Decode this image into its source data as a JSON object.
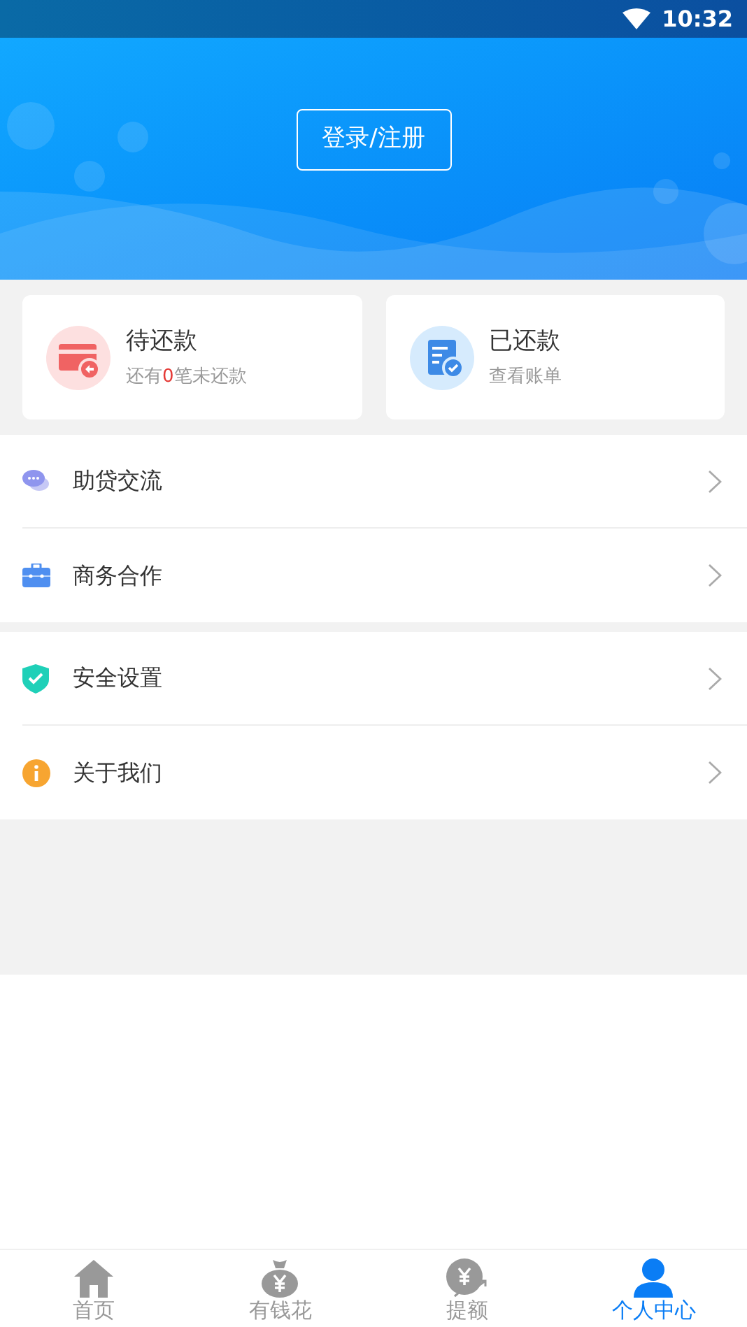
{
  "status_bar": {
    "time": "10:32"
  },
  "header": {
    "login_button": "登录/注册"
  },
  "cards": [
    {
      "kind": "pending",
      "title": "待还款",
      "subtitle": {
        "before": "还有",
        "count": "0",
        "after": "笔未还款"
      }
    },
    {
      "kind": "paid",
      "title": "已还款",
      "subtitle": {
        "before": "查看账单"
      }
    }
  ],
  "menu_groups": [
    [
      {
        "kind": "chat",
        "label": "助贷交流"
      },
      {
        "kind": "briefcase",
        "label": "商务合作"
      }
    ],
    [
      {
        "kind": "shield",
        "label": "安全设置"
      },
      {
        "kind": "info",
        "label": "关于我们"
      }
    ]
  ],
  "tab_bar": [
    {
      "kind": "home",
      "label": "首页",
      "selected": false
    },
    {
      "kind": "moneybag",
      "label": "有钱花",
      "selected": false
    },
    {
      "kind": "coin",
      "label": "提额",
      "selected": false
    },
    {
      "kind": "person",
      "label": "个人中心",
      "selected": true
    }
  ]
}
